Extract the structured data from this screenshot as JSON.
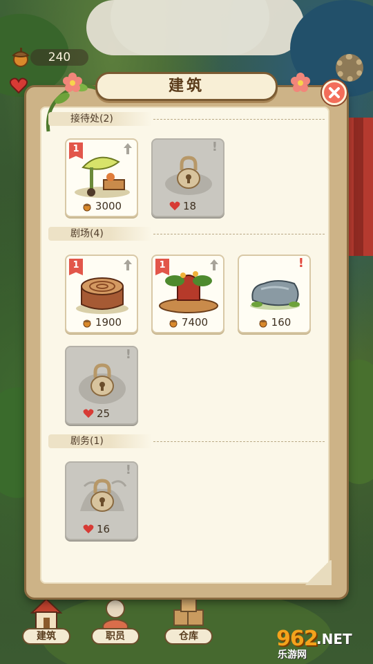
{
  "header": {
    "title": "建筑"
  },
  "hud": {
    "acorn_count": "240"
  },
  "sections": [
    {
      "title": "接待处(2)",
      "items": [
        {
          "level": "1",
          "cost": "3000",
          "currency": "acorn-icon",
          "locked": false,
          "art": "leaf-reception-art"
        },
        {
          "cost": "18",
          "currency": "heart-icon",
          "locked": true
        }
      ]
    },
    {
      "title": "剧场(4)",
      "items": [
        {
          "level": "1",
          "cost": "1900",
          "currency": "acorn-icon",
          "locked": false,
          "art": "tree-stump-art"
        },
        {
          "level": "1",
          "cost": "7400",
          "currency": "acorn-icon",
          "locked": false,
          "art": "garden-stage-art"
        },
        {
          "cost": "160",
          "currency": "acorn-icon",
          "locked": false,
          "art": "grey-rock-art",
          "alert": "!"
        },
        {
          "cost": "25",
          "currency": "heart-icon",
          "locked": true
        }
      ]
    },
    {
      "title": "剧务(1)",
      "items": [
        {
          "cost": "16",
          "currency": "heart-icon",
          "locked": true
        }
      ]
    }
  ],
  "bottom_nav": [
    {
      "label": "建筑",
      "icon": "house-icon"
    },
    {
      "label": "职员",
      "icon": "staff-icon"
    },
    {
      "label": "仓库",
      "icon": "crate-icon"
    }
  ],
  "brand": {
    "number": "962",
    "suffix": ".NET",
    "text": "乐游网"
  },
  "alerts": {
    "grey": "!"
  },
  "colors": {
    "accent": "#e2564a",
    "panel": "#fbf7e8",
    "frame": "#cdb387",
    "locked": "#c9c7c0"
  }
}
